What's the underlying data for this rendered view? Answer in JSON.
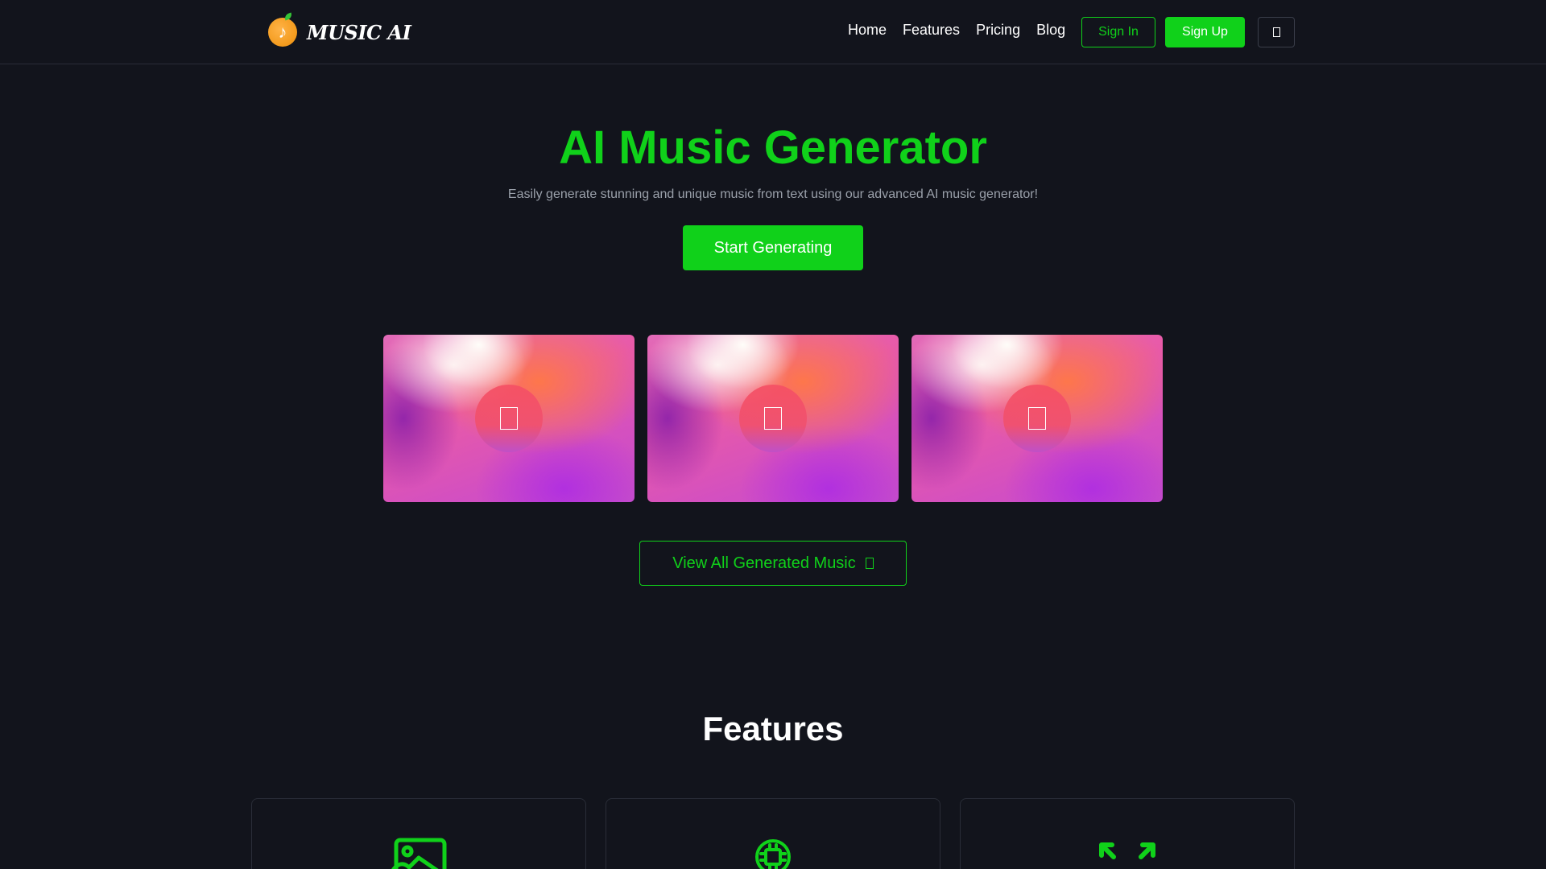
{
  "brand": {
    "name": "MUSIC AI",
    "logo_glyph": "♪",
    "accent_color": "#10d11a"
  },
  "nav": {
    "links": [
      "Home",
      "Features",
      "Pricing",
      "Blog"
    ],
    "sign_in": "Sign In",
    "sign_up": "Sign Up",
    "theme_toggle_icon": "theme-toggle-icon"
  },
  "hero": {
    "title": "AI Music Generator",
    "subtitle": "Easily generate stunning and unique music from text using our advanced AI music generator!",
    "cta": "Start Generating"
  },
  "gallery": {
    "cards": [
      {
        "icon": "play-icon"
      },
      {
        "icon": "play-icon"
      },
      {
        "icon": "play-icon"
      }
    ],
    "view_all": "View All Generated Music",
    "view_all_icon": "arrow-right-icon"
  },
  "features": {
    "title": "Features",
    "cards": [
      {
        "icon": "image-icon"
      },
      {
        "icon": "cpu-chip-icon"
      },
      {
        "icon": "expand-arrows-icon"
      }
    ]
  }
}
